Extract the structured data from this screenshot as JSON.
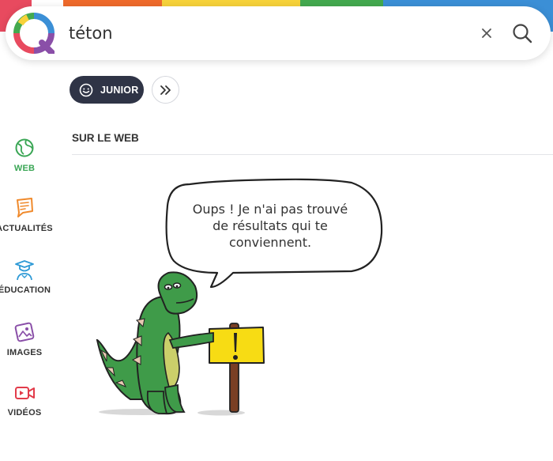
{
  "search": {
    "query": "téton",
    "placeholder": ""
  },
  "filters": {
    "junior_label": "JUNIOR"
  },
  "sidebar": {
    "items": [
      {
        "label": "WEB",
        "icon": "globe-icon",
        "active": true
      },
      {
        "label": "ACTUALITÉS",
        "icon": "news-icon",
        "active": false
      },
      {
        "label": "ÉDUCATION",
        "icon": "graduation-icon",
        "active": false
      },
      {
        "label": "IMAGES",
        "icon": "image-icon",
        "active": false
      },
      {
        "label": "VIDÉOS",
        "icon": "video-icon",
        "active": false
      }
    ]
  },
  "main": {
    "section_title": "SUR LE WEB",
    "empty_message": "Oups ! Je n'ai pas trouvé de résultats qui te conviennent."
  },
  "colors": {
    "web": "#3aa655",
    "news": "#f08a2c",
    "education": "#2f9ad6",
    "images": "#8a4fa8",
    "videos": "#e23b4a",
    "junior_bg": "#2f3446",
    "dino": "#3f9b49",
    "sign": "#f7dc14"
  }
}
